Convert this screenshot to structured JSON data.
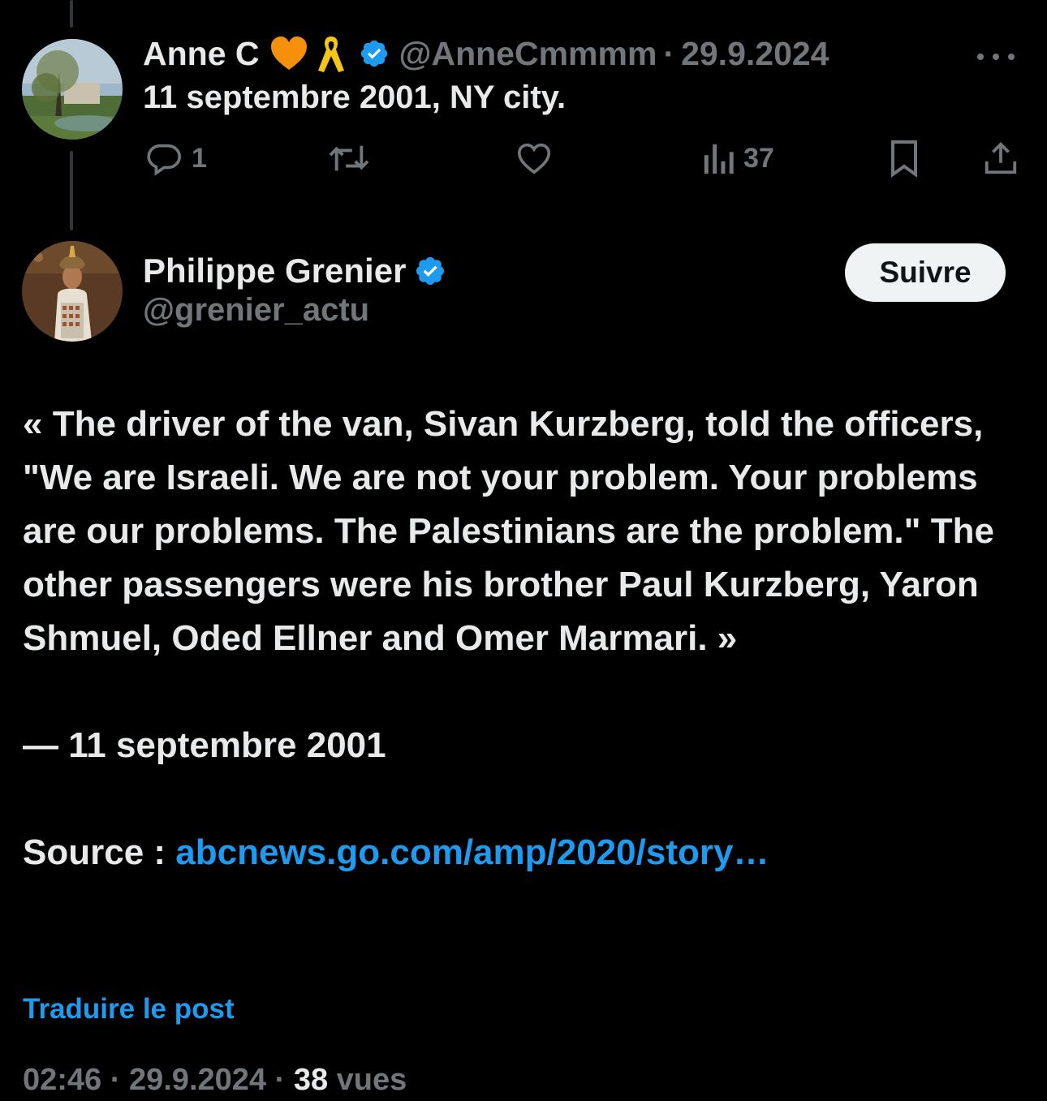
{
  "reply_post": {
    "display_name": "Anne C",
    "emojis": [
      "orange-heart-icon",
      "yellow-ribbon-icon"
    ],
    "handle": "@AnneCmmmm",
    "separator": "·",
    "date": "29.9.2024",
    "text": "11 septembre 2001, NY city.",
    "actions": {
      "replies": "1",
      "views": "37"
    }
  },
  "main_post": {
    "display_name": "Philippe Grenier",
    "handle": "@grenier_actu",
    "follow_label": "Suivre",
    "body": {
      "quote": "« The driver of the van, Sivan Kurzberg, told the officers, \"We are Israeli. We are not your problem. Your problems are our problems. The Palestinians are the problem.\" The other passengers were his brother Paul Kurzberg, Yaron Shmuel, Oded Ellner and Omer Marmari. »",
      "attribution": "— 11 septembre 2001",
      "source_label": "Source : ",
      "source_link": "abcnews.go.com/amp/2020/story…"
    },
    "translate_label": "Traduire le post",
    "time": "02:46",
    "sep1": " · ",
    "date": "29.9.2024",
    "sep2": " · ",
    "views_count": "38",
    "views_label": " vues"
  },
  "colors": {
    "background": "#000000",
    "text": "#e7e9ea",
    "muted": "#71767b",
    "accent": "#1d9bf0",
    "verified": "#1d9bf0",
    "follow_bg": "#eff3f4"
  }
}
